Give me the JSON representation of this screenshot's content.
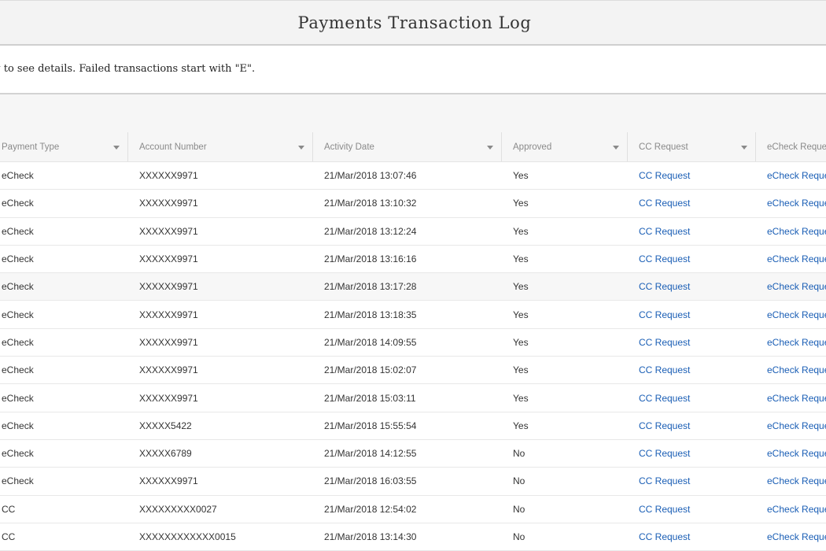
{
  "header": {
    "title": "Payments Transaction Log"
  },
  "notice": {
    "text": "Click a row to see details. Failed transactions start with \"E\"."
  },
  "table": {
    "columns": [
      "Payment Type",
      "Account Number",
      "Activity Date",
      "Approved",
      "CC Request",
      "eCheck Request"
    ],
    "rows": [
      {
        "type": "eCheck",
        "account": "XXXXXX9971",
        "date": "21/Mar/2018 13:07:46",
        "approved": "Yes",
        "cc": "CC Request",
        "echeck": "eCheck Request"
      },
      {
        "type": "eCheck",
        "account": "XXXXXX9971",
        "date": "21/Mar/2018 13:10:32",
        "approved": "Yes",
        "cc": "CC Request",
        "echeck": "eCheck Request"
      },
      {
        "type": "eCheck",
        "account": "XXXXXX9971",
        "date": "21/Mar/2018 13:12:24",
        "approved": "Yes",
        "cc": "CC Request",
        "echeck": "eCheck Request"
      },
      {
        "type": "eCheck",
        "account": "XXXXXX9971",
        "date": "21/Mar/2018 13:16:16",
        "approved": "Yes",
        "cc": "CC Request",
        "echeck": "eCheck Request"
      },
      {
        "type": "eCheck",
        "account": "XXXXXX9971",
        "date": "21/Mar/2018 13:17:28",
        "approved": "Yes",
        "cc": "CC Request",
        "echeck": "eCheck Request"
      },
      {
        "type": "eCheck",
        "account": "XXXXXX9971",
        "date": "21/Mar/2018 13:18:35",
        "approved": "Yes",
        "cc": "CC Request",
        "echeck": "eCheck Request"
      },
      {
        "type": "eCheck",
        "account": "XXXXXX9971",
        "date": "21/Mar/2018 14:09:55",
        "approved": "Yes",
        "cc": "CC Request",
        "echeck": "eCheck Request"
      },
      {
        "type": "eCheck",
        "account": "XXXXXX9971",
        "date": "21/Mar/2018 15:02:07",
        "approved": "Yes",
        "cc": "CC Request",
        "echeck": "eCheck Request"
      },
      {
        "type": "eCheck",
        "account": "XXXXXX9971",
        "date": "21/Mar/2018 15:03:11",
        "approved": "Yes",
        "cc": "CC Request",
        "echeck": "eCheck Request"
      },
      {
        "type": "eCheck",
        "account": "XXXXX5422",
        "date": "21/Mar/2018 15:55:54",
        "approved": "Yes",
        "cc": "CC Request",
        "echeck": "eCheck Request"
      },
      {
        "type": "eCheck",
        "account": "XXXXX6789",
        "date": "21/Mar/2018 14:12:55",
        "approved": "No",
        "cc": "CC Request",
        "echeck": "eCheck Request"
      },
      {
        "type": "eCheck",
        "account": "XXXXXX9971",
        "date": "21/Mar/2018 16:03:55",
        "approved": "No",
        "cc": "CC Request",
        "echeck": "eCheck Request"
      },
      {
        "type": "CC",
        "account": "XXXXXXXXX0027",
        "date": "21/Mar/2018 12:54:02",
        "approved": "No",
        "cc": "CC Request",
        "echeck": "eCheck Request"
      },
      {
        "type": "CC",
        "account": "XXXXXXXXXXXX0015",
        "date": "21/Mar/2018 13:14:30",
        "approved": "No",
        "cc": "CC Request",
        "echeck": "eCheck Request"
      }
    ]
  }
}
